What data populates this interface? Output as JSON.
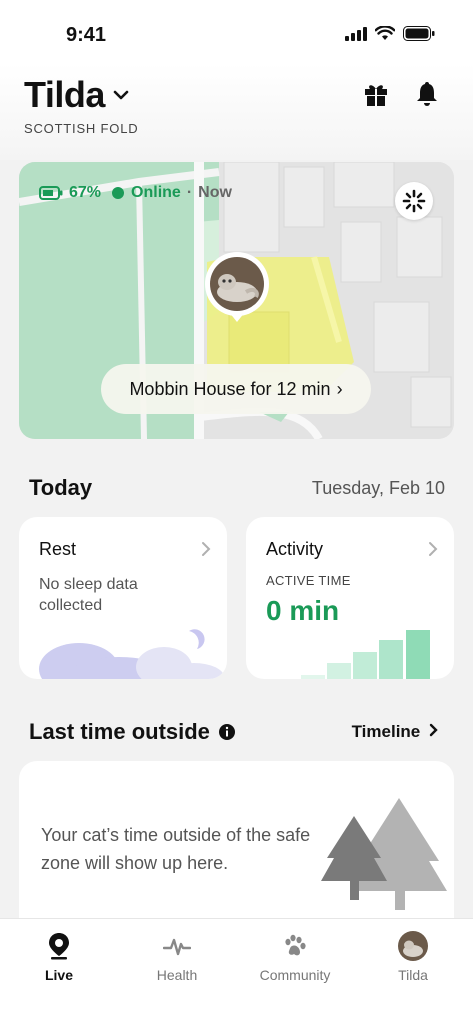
{
  "status_bar": {
    "time": "9:41"
  },
  "header": {
    "pet_name": "Tilda",
    "breed": "SCOTTISH FOLD",
    "gift_icon": "gift-icon",
    "bell_icon": "bell-icon"
  },
  "map": {
    "battery": "67%",
    "online": "Online",
    "separator": "·",
    "updated": "Now",
    "location_name": "Mobbin House",
    "duration": "for 12 min",
    "arrow": "›"
  },
  "today": {
    "title": "Today",
    "date": "Tuesday, Feb 10",
    "rest": {
      "title": "Rest",
      "text": "No sleep data collected"
    },
    "activity": {
      "title": "Activity",
      "label": "ACTIVE TIME",
      "value": "0 min"
    }
  },
  "outside": {
    "title": "Last time outside",
    "timeline": "Timeline",
    "message": "Your cat’s time outside of the safe zone will show up here."
  },
  "tabs": [
    {
      "label": "Live",
      "icon": "location-pin-icon"
    },
    {
      "label": "Health",
      "icon": "pulse-icon"
    },
    {
      "label": "Community",
      "icon": "paw-icon"
    },
    {
      "label": "Tilda",
      "icon": "avatar"
    }
  ],
  "colors": {
    "accent_green": "#1a9a57",
    "map_green": "#b5dfc5",
    "safe_zone": "#eff07c",
    "cloud": "#cdcdf0",
    "bar_green": "#8fdbb6"
  }
}
